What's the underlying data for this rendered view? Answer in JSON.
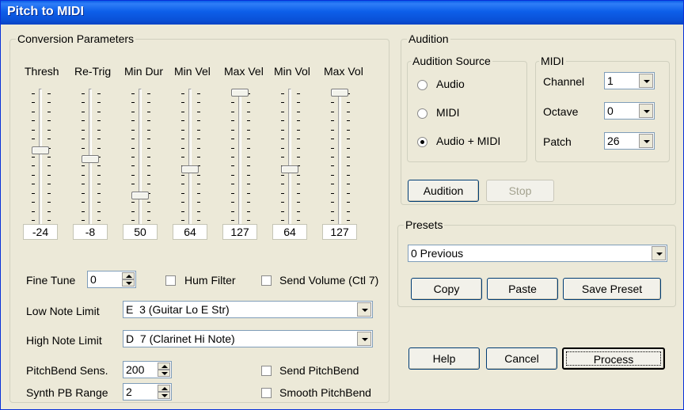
{
  "window": {
    "title": "Pitch to MIDI"
  },
  "conversion": {
    "legend": "Conversion Parameters",
    "sliders": [
      {
        "label": "Thresh",
        "value": "-24",
        "level": 0.45
      },
      {
        "label": "Re-Trig",
        "value": "-8",
        "level": 0.52
      },
      {
        "label": "Min Dur",
        "value": "50",
        "level": 0.8
      },
      {
        "label": "Min Vel",
        "value": "64",
        "level": 0.6
      },
      {
        "label": "Max Vel",
        "value": "127",
        "level": 0.0
      },
      {
        "label": "Min Vol",
        "value": "64",
        "level": 0.6
      },
      {
        "label": "Max Vol",
        "value": "127",
        "level": 0.0
      }
    ],
    "fine_tune": {
      "label": "Fine Tune",
      "value": "0"
    },
    "hum_filter": {
      "label": "Hum Filter",
      "checked": false
    },
    "send_volume": {
      "label": "Send Volume (Ctl 7)",
      "checked": false
    },
    "low_note": {
      "label": "Low Note Limit",
      "value": "E  3 (Guitar Lo E Str)"
    },
    "high_note": {
      "label": "High Note Limit",
      "value": "D  7 (Clarinet Hi Note)"
    },
    "pb_sens": {
      "label": "PitchBend Sens.",
      "value": "200"
    },
    "send_pb": {
      "label": "Send PitchBend",
      "checked": false
    },
    "synth_pb": {
      "label": "Synth PB Range",
      "value": "2"
    },
    "smooth_pb": {
      "label": "Smooth PitchBend",
      "checked": false
    }
  },
  "audition": {
    "legend": "Audition",
    "source": {
      "legend": "Audition Source",
      "options": [
        "Audio",
        "MIDI",
        "Audio + MIDI"
      ],
      "selected": "Audio + MIDI"
    },
    "midi": {
      "legend": "MIDI",
      "channel": {
        "label": "Channel",
        "value": "1"
      },
      "octave": {
        "label": "Octave",
        "value": "0"
      },
      "patch": {
        "label": "Patch",
        "value": "26"
      }
    },
    "audition_button": "Audition",
    "stop_button": "Stop"
  },
  "presets": {
    "legend": "Presets",
    "value": "0 Previous",
    "copy": "Copy",
    "paste": "Paste",
    "save": "Save Preset"
  },
  "footer": {
    "help": "Help",
    "cancel": "Cancel",
    "process": "Process"
  }
}
